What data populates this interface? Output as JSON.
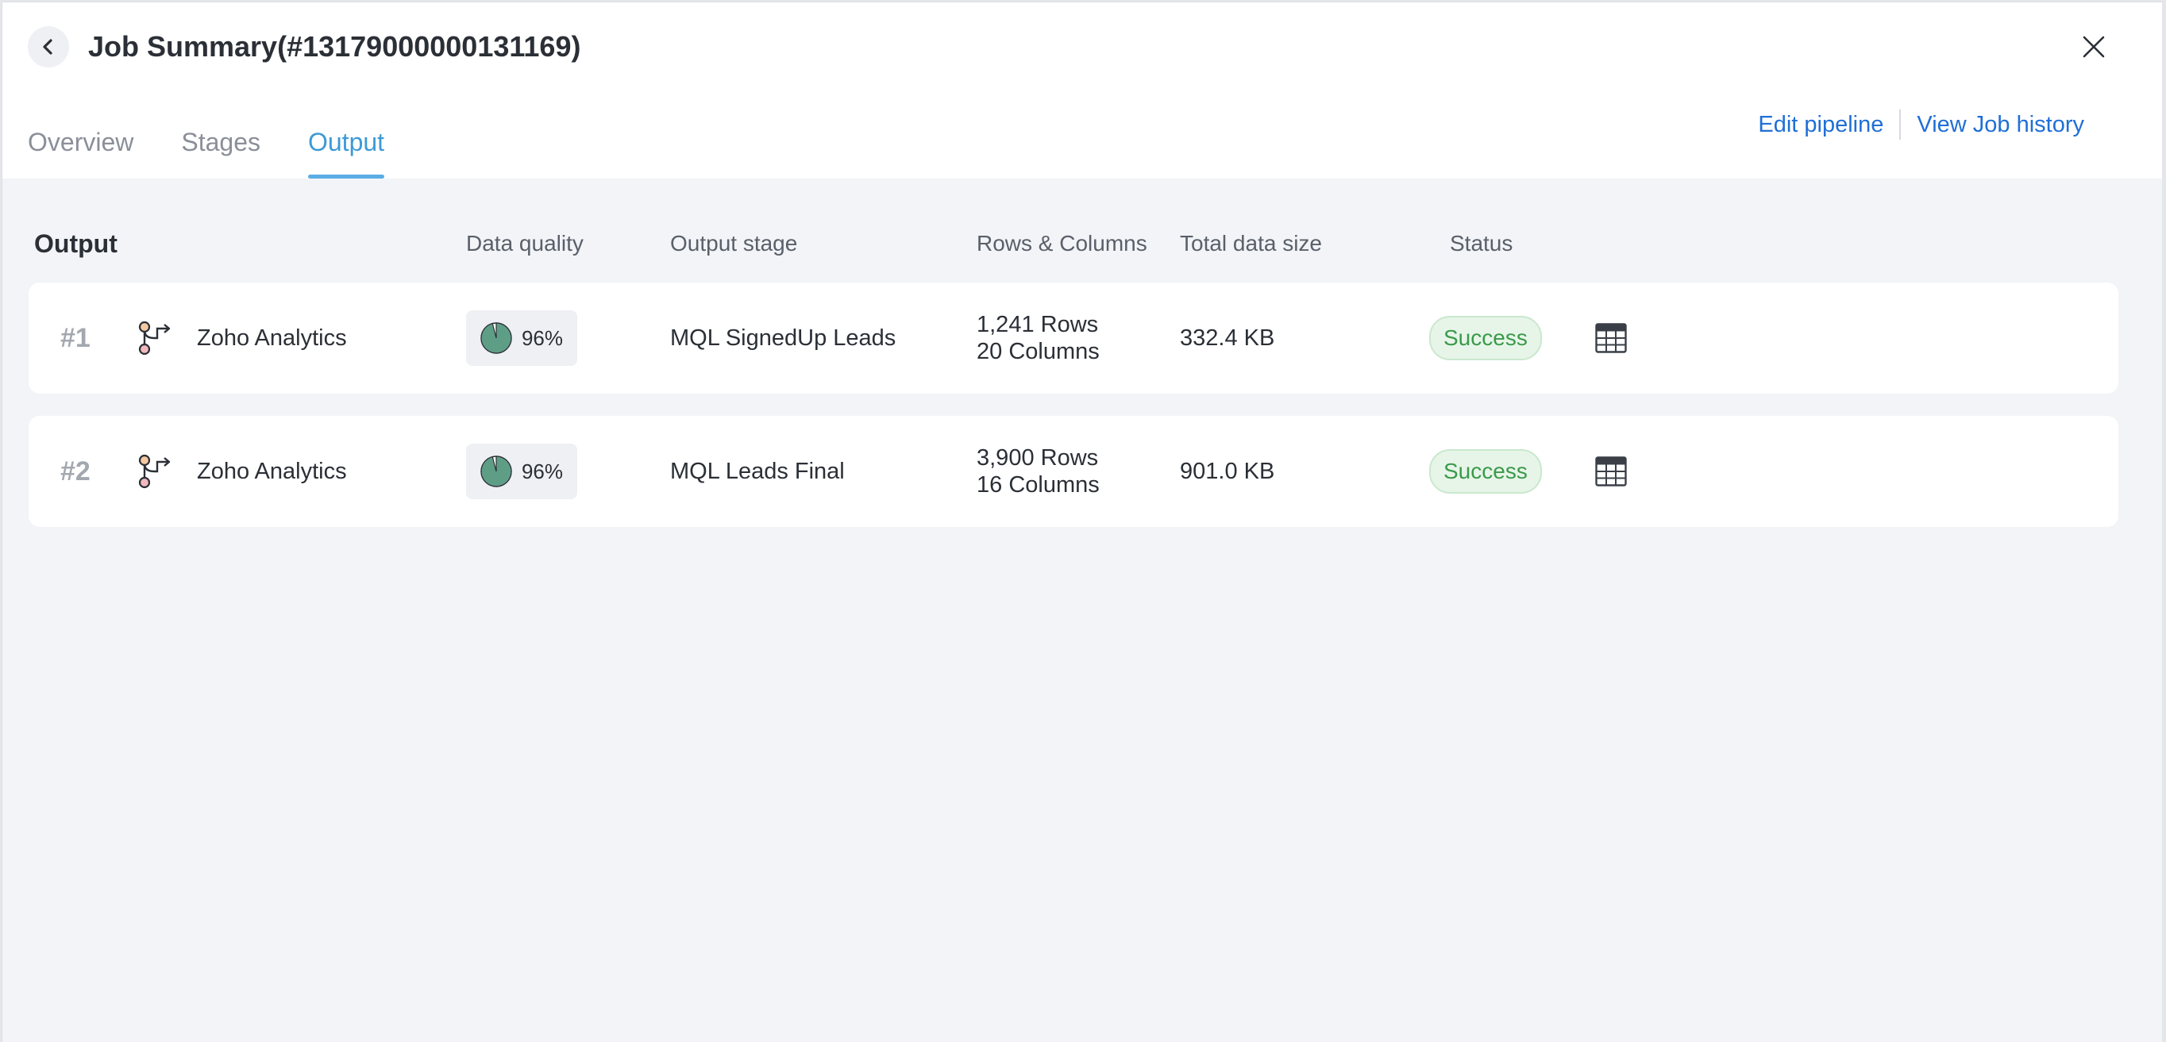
{
  "header": {
    "title": "Job Summary(#13179000000131169)",
    "links": {
      "edit_pipeline": "Edit pipeline",
      "view_job_history": "View Job history"
    }
  },
  "tabs": [
    {
      "label": "Overview",
      "active": false
    },
    {
      "label": "Stages",
      "active": false
    },
    {
      "label": "Output",
      "active": true
    }
  ],
  "table": {
    "section_title": "Output",
    "columns": {
      "data_quality": "Data quality",
      "output_stage": "Output stage",
      "rows_columns": "Rows & Columns",
      "total_data_size": "Total data size",
      "status": "Status"
    },
    "rows": [
      {
        "index": "#1",
        "destination": "Zoho Analytics",
        "data_quality": "96%",
        "data_quality_value": 0.96,
        "output_stage": "MQL SignedUp Leads",
        "rows": "1,241 Rows",
        "columns": "20 Columns",
        "size": "332.4 KB",
        "status": "Success"
      },
      {
        "index": "#2",
        "destination": "Zoho Analytics",
        "data_quality": "96%",
        "data_quality_value": 0.96,
        "output_stage": "MQL Leads Final",
        "rows": "3,900 Rows",
        "columns": "16 Columns",
        "size": "901.0 KB",
        "status": "Success"
      }
    ]
  },
  "colors": {
    "accent": "#3d9ad6",
    "link": "#1f6fd6",
    "success_text": "#3a9a4a",
    "success_bg": "#e7f5e9",
    "quality_pie": "#5f9e86"
  },
  "icons": {
    "back": "chevron-left-icon",
    "close": "close-icon",
    "destination": "pipeline-output-icon",
    "data_quality": "pie-chart-icon",
    "view_data": "table-grid-icon"
  }
}
